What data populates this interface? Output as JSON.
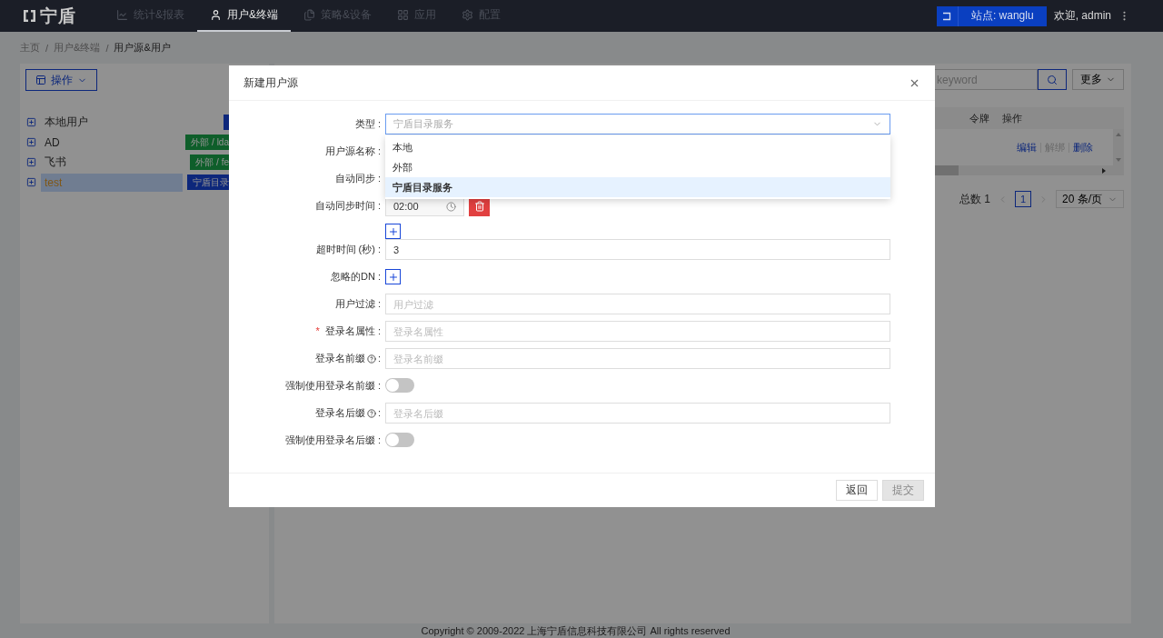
{
  "nav": {
    "logo": "宁盾",
    "items": [
      {
        "label": "统计&报表",
        "selected": false
      },
      {
        "label": "用户&终端",
        "selected": true
      },
      {
        "label": "策略&设备",
        "selected": false
      },
      {
        "label": "应用",
        "selected": false
      },
      {
        "label": "配置",
        "selected": false
      }
    ],
    "site": "站点: wanglu",
    "welcome": "欢迎, admin"
  },
  "breadcrumb": [
    {
      "label": "主页",
      "separator": "/"
    },
    {
      "label": "用户&终端",
      "separator": "/"
    },
    {
      "label": "用户源&用户"
    }
  ],
  "actions_button": "操作",
  "tree": [
    {
      "label": "本地用户",
      "selected": false,
      "tag": {
        "kind": "local"
      }
    },
    {
      "label": "AD",
      "selected": false,
      "tag": {
        "text": "外部 / lda",
        "kind": "external"
      }
    },
    {
      "label": "飞书",
      "selected": false,
      "tag": {
        "text": "外部 / fe",
        "kind": "external"
      }
    },
    {
      "label": "test",
      "selected": true,
      "tag": {
        "text": "宁盾目录",
        "kind": "directory"
      }
    }
  ],
  "search": {
    "placeholder": "keyword"
  },
  "more_button": "更多",
  "table": {
    "columns": [
      "令牌",
      "操作"
    ],
    "rows": [
      {
        "actions": [
          {
            "label": "编辑",
            "disabled": false
          },
          {
            "label": "解绑",
            "disabled": true
          },
          {
            "label": "删除",
            "disabled": false
          }
        ]
      }
    ]
  },
  "pagination": {
    "total": "总数 1",
    "pages": [
      {
        "label": "1",
        "selected": true
      }
    ],
    "page_size": "20 条/页"
  },
  "footer": "Copyright © 2009-2022 上海宁盾信息科技有限公司 All rights reserved",
  "dialog": {
    "title": "新建用户源",
    "fields": [
      {
        "kind": "select",
        "label": "类型 :",
        "placeholder": "宁盾目录服务",
        "open": true,
        "options": [
          {
            "label": "本地",
            "selected": false
          },
          {
            "label": "外部",
            "selected": false
          },
          {
            "label": "宁盾目录服务",
            "selected": true
          }
        ]
      },
      {
        "kind": "covered",
        "label": "用户源名称 :"
      },
      {
        "kind": "covered",
        "label": "自动同步 :"
      },
      {
        "kind": "time_list",
        "label": "自动同步时间 :",
        "value": "02:00"
      },
      {
        "kind": "input",
        "label": "超时时间 (秒) :",
        "value": "3"
      },
      {
        "kind": "add",
        "label": "忽略的DN :"
      },
      {
        "kind": "input",
        "label": "用户过滤 :",
        "placeholder": "用户过滤"
      },
      {
        "kind": "input",
        "label": "登录名属性 :",
        "placeholder": "登录名属性",
        "required_mark": "*"
      },
      {
        "kind": "input",
        "label": "登录名前缀",
        "label_end": ":",
        "placeholder": "登录名前缀",
        "help": true
      },
      {
        "kind": "switch",
        "label": "强制使用登录名前缀 :",
        "on": false
      },
      {
        "kind": "input",
        "label": "登录名后缀",
        "label_end": ":",
        "placeholder": "登录名后缀",
        "help": true
      },
      {
        "kind": "switch",
        "label": "强制使用登录名后缀 :",
        "on": false
      }
    ],
    "buttons": [
      {
        "label": "返回",
        "disabled": false
      },
      {
        "label": "提交",
        "disabled": true
      }
    ]
  }
}
